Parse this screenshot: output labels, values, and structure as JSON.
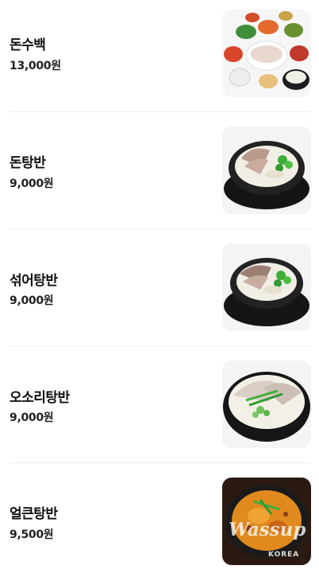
{
  "menu": {
    "items": [
      {
        "name": "돈수백",
        "price": "13,000원",
        "image": "boiled-pork-platter-with-side-dishes"
      },
      {
        "name": "돈탕반",
        "price": "9,000원",
        "image": "pork-soup-in-black-pot"
      },
      {
        "name": "섞어탕반",
        "price": "9,000원",
        "image": "mixed-pork-soup-in-black-pot"
      },
      {
        "name": "오소리탕반",
        "price": "9,000원",
        "image": "pork-soup-with-chives"
      },
      {
        "name": "얼큰탕반",
        "price": "9,500원",
        "image": "spicy-pork-soup"
      }
    ]
  },
  "watermark": {
    "word": "Wassup",
    "sub": "KOREA"
  },
  "colors": {
    "soup_broth": "#f4f1ea",
    "pot": "#1b1b1b",
    "spicy_broth": "#e08a1e",
    "chive": "#3fae3a"
  }
}
